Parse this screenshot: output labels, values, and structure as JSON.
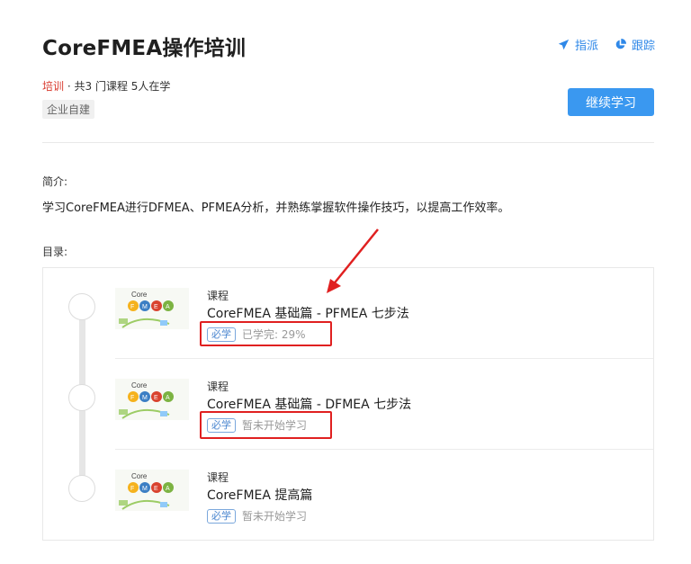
{
  "header": {
    "title": "CoreFMEA操作培训",
    "actions": [
      {
        "label": "指派",
        "icon": "send-icon"
      },
      {
        "label": "跟踪",
        "icon": "pie-chart-icon"
      }
    ]
  },
  "meta": {
    "category": "培训",
    "separator": "·",
    "summary": "共3 门课程 5人在学",
    "tag": "企业自建"
  },
  "continue_button": "继续学习",
  "intro": {
    "label": "简介:",
    "text": "学习CoreFMEA进行DFMEA、PFMEA分析，并熟练掌握软件操作技巧，以提高工作效率。"
  },
  "catalog": {
    "label": "目录:",
    "courses": [
      {
        "type": "课程",
        "title": "CoreFMEA 基础篇 - PFMEA 七步法",
        "badge": "必学",
        "status": "已学完: 29%",
        "progress": 0.29
      },
      {
        "type": "课程",
        "title": "CoreFMEA 基础篇 - DFMEA 七步法",
        "badge": "必学",
        "status": "暂未开始学习"
      },
      {
        "type": "课程",
        "title": "CoreFMEA 提高篇",
        "badge": "必学",
        "status": "暂未开始学习"
      }
    ]
  },
  "thumbnail": {
    "logo_text": "Core",
    "letters": [
      "F",
      "M",
      "E",
      "A"
    ]
  },
  "colors": {
    "accent": "#3a98f0",
    "category": "#d8382c",
    "highlight": "#e02020"
  }
}
